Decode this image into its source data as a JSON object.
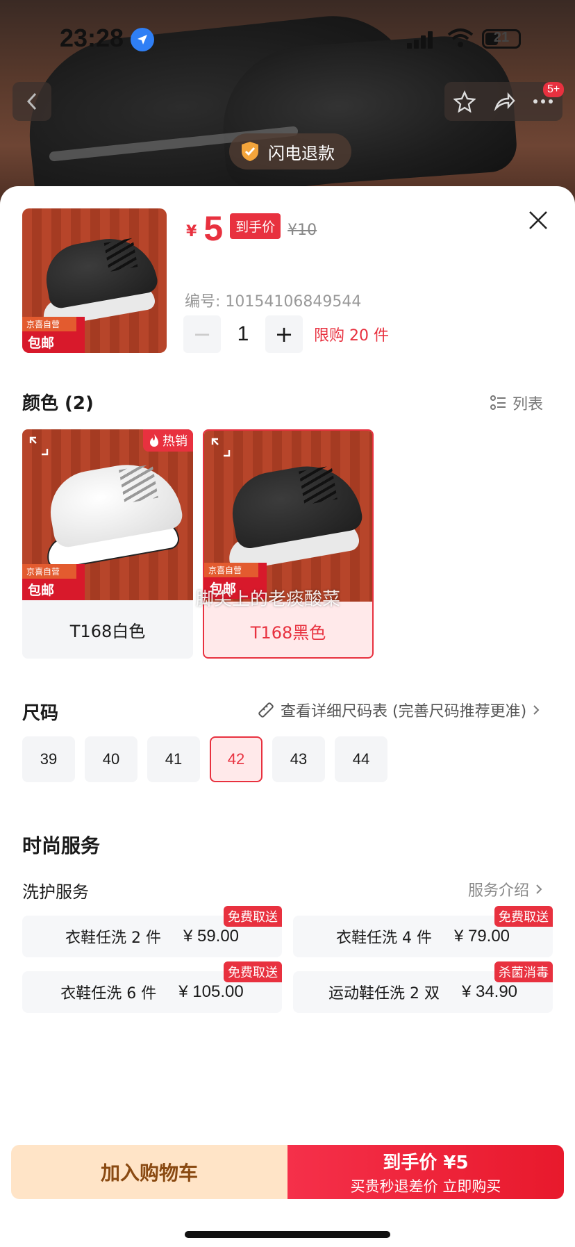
{
  "status_bar": {
    "time": "23:28",
    "battery": "21"
  },
  "header": {
    "badge_count": "5+",
    "refund_label": "闪电退款"
  },
  "product": {
    "price_symbol": "¥",
    "price": "5",
    "price_tag": "到手价",
    "original_price": "¥10",
    "sku_label": "编号:",
    "sku": "10154106849544",
    "quantity": "1",
    "limit": "限购 20 件",
    "ship_tag_top": "京喜自营",
    "ship_tag_bottom": "包邮"
  },
  "color": {
    "title": "颜色 (2)",
    "list_label": "列表",
    "hot_label": "热销",
    "options": [
      {
        "label": "T168白色",
        "selected": false
      },
      {
        "label": "T168黑色",
        "selected": true
      }
    ],
    "watermark": "脚尖上的老痰酸菜"
  },
  "size": {
    "title": "尺码",
    "chart_link": "查看详细尺码表 (完善尺码推荐更准)",
    "options": [
      "39",
      "40",
      "41",
      "42",
      "43",
      "44"
    ],
    "selected": "42"
  },
  "services": {
    "title": "时尚服务",
    "subtitle": "洗护服务",
    "intro_link": "服务介绍",
    "items": [
      {
        "name": "衣鞋任洗 2 件",
        "price": "¥ 59.00",
        "tag": "免费取送"
      },
      {
        "name": "衣鞋任洗 4 件",
        "price": "¥ 79.00",
        "tag": "免费取送"
      },
      {
        "name": "衣鞋任洗 6 件",
        "price": "¥ 105.00",
        "tag": "免费取送"
      },
      {
        "name": "运动鞋任洗 2 双",
        "price": "¥ 34.90",
        "tag": "杀菌消毒"
      }
    ]
  },
  "actions": {
    "cart": "加入购物车",
    "buy_title": "到手价 ¥5",
    "buy_subtitle": "买贵秒退差价 立即购买"
  },
  "colors": {
    "accent": "#e8313f",
    "cart_bg": "#ffe4c7",
    "cart_text": "#8a4a12"
  }
}
